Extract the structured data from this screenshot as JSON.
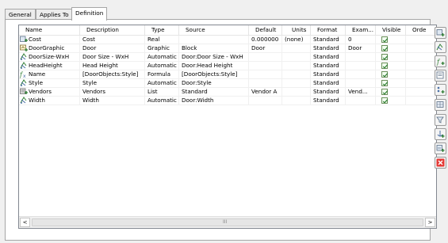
{
  "tabs": [
    {
      "label": "General"
    },
    {
      "label": "Applies To"
    },
    {
      "label": "Definition",
      "active": true
    }
  ],
  "table": {
    "columns": [
      "Name",
      "Description",
      "Type",
      "Source",
      "Default",
      "Units",
      "Format",
      "Exam...",
      "Visible",
      "Orde"
    ],
    "rows": [
      {
        "icon": "property-manual-icon",
        "name": "Cost",
        "description": "Cost",
        "type": "Real",
        "source": "",
        "default": "0.000000",
        "units": "(none)",
        "format": "Standard",
        "example": "0",
        "visible": true
      },
      {
        "icon": "property-graphic-icon",
        "name": "DoorGraphic",
        "description": "Door",
        "type": "Graphic",
        "source": "Block",
        "default": "Door",
        "units": "",
        "format": "Standard",
        "example": "Door",
        "visible": true
      },
      {
        "icon": "property-automatic-icon",
        "name": "DoorSize-WxH",
        "description": "Door Size - WxH",
        "type": "Automatic",
        "source": "Door:Door Size - WxH",
        "default": "",
        "units": "",
        "format": "Standard",
        "example": "",
        "visible": true
      },
      {
        "icon": "property-automatic-icon",
        "name": "HeadHeight",
        "description": "Head Height",
        "type": "Automatic",
        "source": "Door:Head Height",
        "default": "",
        "units": "",
        "format": "Standard",
        "example": "",
        "visible": true
      },
      {
        "icon": "property-formula-icon",
        "name": "Name",
        "description": "[DoorObjects:Style]",
        "type": "Formula",
        "source": "[DoorObjects:Style]",
        "default": "",
        "units": "",
        "format": "Standard",
        "example": "",
        "visible": true
      },
      {
        "icon": "property-automatic-icon",
        "name": "Style",
        "description": "Style",
        "type": "Automatic",
        "source": "Door:Style",
        "default": "",
        "units": "",
        "format": "Standard",
        "example": "",
        "visible": true
      },
      {
        "icon": "property-list-icon",
        "name": "Vendors",
        "description": "Vendors",
        "type": "List",
        "source": "Standard",
        "default": "Vendor A",
        "units": "",
        "format": "Standard",
        "example": "Vend...",
        "visible": true
      },
      {
        "icon": "property-automatic-icon",
        "name": "Width",
        "description": "Width",
        "type": "Automatic",
        "source": "Door:Width",
        "default": "",
        "units": "",
        "format": "Standard",
        "example": "",
        "visible": true
      }
    ]
  },
  "scrollbar": {
    "left_arrow": "<",
    "right_arrow": ">",
    "grip": "III"
  },
  "toolbar": [
    {
      "name": "add-manual-property-button",
      "icon": "add-manual-property-icon",
      "color": "#2e7d32"
    },
    {
      "name": "add-automatic-property-button",
      "icon": "add-automatic-property-icon",
      "color": "#2e7d32"
    },
    {
      "name": "add-formula-property-button",
      "icon": "add-formula-property-icon",
      "color": "#2e7d32"
    },
    {
      "name": "add-location-property-button",
      "icon": "add-location-property-icon",
      "color": "#2e7d32"
    },
    {
      "name": "add-classification-property-button",
      "icon": "add-classification-property-icon",
      "color": "#2e7d32"
    },
    {
      "name": "add-material-property-button",
      "icon": "add-material-property-icon",
      "color": "#2e7d32"
    },
    {
      "name": "add-graphic-property-button",
      "icon": "add-graphic-property-icon",
      "color": "#2e7d32"
    },
    {
      "name": "add-anchor-property-button",
      "icon": "add-anchor-property-icon",
      "color": "#2e7d32"
    },
    {
      "name": "add-property-set-button",
      "icon": "add-property-set-icon",
      "color": "#2e7d32"
    },
    {
      "name": "remove-property-button",
      "icon": "remove-icon",
      "color": "#d32f2f"
    }
  ]
}
